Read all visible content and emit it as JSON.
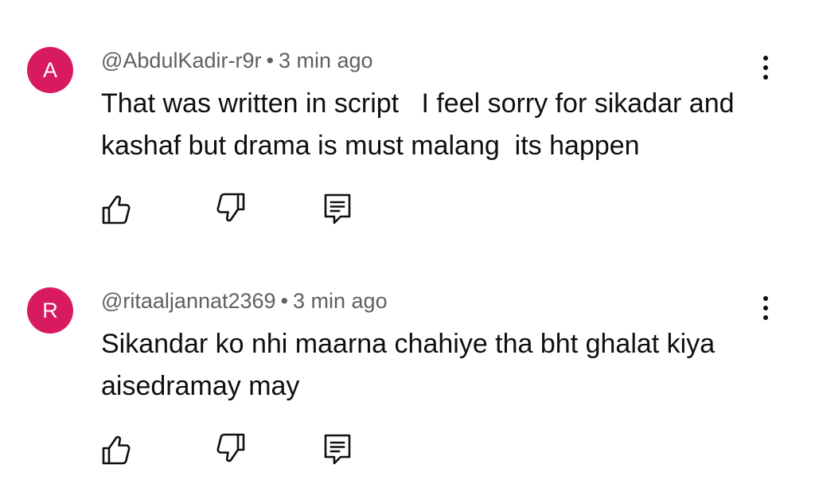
{
  "comments": [
    {
      "avatar_letter": "A",
      "avatar_color": "#d81b60",
      "handle": "@AbdulKadir-r9r",
      "separator": "•",
      "time": "3 min ago",
      "text": "That was written in script   I feel sorry for sikadar and kashaf but drama is must malang  its happen",
      "icons": {
        "like": "thumbs-up-icon",
        "dislike": "thumbs-down-icon",
        "reply": "reply-icon",
        "more": "more-vert-icon"
      }
    },
    {
      "avatar_letter": "R",
      "avatar_color": "#d81b60",
      "handle": "@ritaaljannat2369",
      "separator": "•",
      "time": "3 min ago",
      "text": "Sikandar ko nhi maarna chahiye tha bht ghalat kiya aisedramay may",
      "icons": {
        "like": "thumbs-up-icon",
        "dislike": "thumbs-down-icon",
        "reply": "reply-icon",
        "more": "more-vert-icon"
      }
    }
  ]
}
